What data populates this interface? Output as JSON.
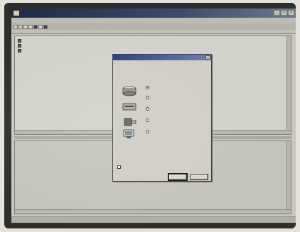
{
  "window": {
    "title": "",
    "controls": [
      "_",
      "□",
      "×"
    ]
  },
  "menu": [],
  "toolbar": [],
  "address": "",
  "tree": [],
  "dialog": {
    "title": "",
    "close": "×",
    "prompt": "",
    "options": [
      {
        "label": "",
        "selected": true,
        "icon": "drive-icon"
      },
      {
        "label": "",
        "selected": false,
        "icon": "drive-icon"
      },
      {
        "label": "",
        "selected": false,
        "icon": "drive-icon"
      },
      {
        "label": "",
        "selected": false,
        "icon": "plug-icon"
      },
      {
        "label": "",
        "selected": false,
        "icon": "network-icon"
      }
    ],
    "checkbox_label": "",
    "ok": "",
    "cancel": ""
  },
  "colors": {
    "titlebar": "#1e2a4a",
    "dialog_titlebar": "#2a3c78",
    "window_bg": "#c8c8c0"
  }
}
